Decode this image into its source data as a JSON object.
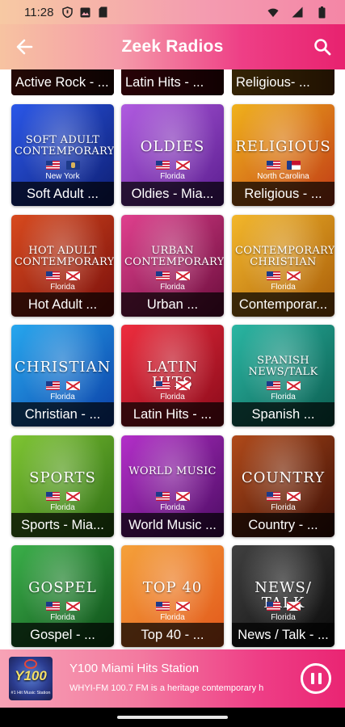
{
  "status_bar": {
    "time": "11:28",
    "left_icons": [
      "shield-icon",
      "image-icon",
      "sd-card-icon"
    ],
    "right_icons": [
      "wifi-icon",
      "signal-icon",
      "battery-icon"
    ]
  },
  "app_bar": {
    "title": "Zeek Radios",
    "back_icon": "arrow-left-icon",
    "search_icon": "search-icon"
  },
  "partial_row": [
    {
      "caption": "Active Rock - ..."
    },
    {
      "caption": "Latin Hits - ..."
    },
    {
      "caption": "Religious- ..."
    }
  ],
  "tiles": [
    {
      "genre": "Soft Adult Contemporary",
      "state": "New York",
      "caption": "Soft Adult ...",
      "colors": [
        "#2a57e8",
        "#0e1e72"
      ],
      "flag": "ny"
    },
    {
      "genre": "Oldies",
      "state": "Florida",
      "caption": "Oldies - Mia...",
      "colors": [
        "#b05be0",
        "#5a1d8f"
      ],
      "flag": "fl"
    },
    {
      "genre": "Religious",
      "state": "North Carolina",
      "caption": "Religious - ...",
      "colors": [
        "#f0b21c",
        "#c13a16"
      ],
      "flag": "nc"
    },
    {
      "genre": "Hot Adult Contemporary",
      "state": "Florida",
      "caption": "Hot Adult ...",
      "colors": [
        "#d84a1e",
        "#7a0f0c"
      ],
      "flag": "fl"
    },
    {
      "genre": "Urban Contemporary",
      "state": "Florida",
      "caption": "Urban ...",
      "colors": [
        "#e0408e",
        "#6b0d3c"
      ],
      "flag": "fl"
    },
    {
      "genre": "Contemporary Christian",
      "state": "Florida",
      "caption": "Contemporar...",
      "colors": [
        "#f3b72b",
        "#a85c09"
      ],
      "flag": "fl"
    },
    {
      "genre": "Christian",
      "state": "Florida",
      "caption": "Christian - ...",
      "colors": [
        "#27a7ee",
        "#0b3fa7"
      ],
      "flag": "fl"
    },
    {
      "genre": "Latin Hits",
      "state": "Florida",
      "caption": "Latin Hits - ...",
      "colors": [
        "#ee2d3e",
        "#8a0a1a"
      ],
      "flag": "fl"
    },
    {
      "genre": "Spanish News/Talk",
      "state": "Florida",
      "caption": "Spanish ...",
      "colors": [
        "#2ab6a3",
        "#0b5c4f"
      ],
      "flag": "fl"
    },
    {
      "genre": "Sports",
      "state": "Florida",
      "caption": "Sports - Mia...",
      "colors": [
        "#7fc533",
        "#2d6d14"
      ],
      "flag": "fl"
    },
    {
      "genre": "World Music",
      "state": "Florida",
      "caption": "World Music ...",
      "colors": [
        "#b32fc9",
        "#4c0c63"
      ],
      "flag": "fl"
    },
    {
      "genre": "Country",
      "state": "Florida",
      "caption": "Country - ...",
      "colors": [
        "#b04a1a",
        "#3d0f06"
      ],
      "flag": "fl"
    },
    {
      "genre": "Gospel",
      "state": "Florida",
      "caption": "Gospel - ...",
      "colors": [
        "#3bb04a",
        "#0e4d18"
      ],
      "flag": "fl"
    },
    {
      "genre": "Top 40",
      "state": "Florida",
      "caption": "Top 40 - ...",
      "colors": [
        "#f5a13a",
        "#e2571b"
      ],
      "flag": "fl"
    },
    {
      "genre": "News/ Talk",
      "state": "Florida",
      "caption": "News / Talk - ...",
      "colors": [
        "#404040",
        "#0a0a0a"
      ],
      "flag": "fl"
    }
  ],
  "player": {
    "station_name": "Y100 Miami Hits Station",
    "description": "WHYI-FM 100.7 FM is a heritage contemporary h",
    "logo_text": "Y100",
    "logo_sub": "#1 Hit Music Station",
    "pause_icon": "pause-icon"
  }
}
